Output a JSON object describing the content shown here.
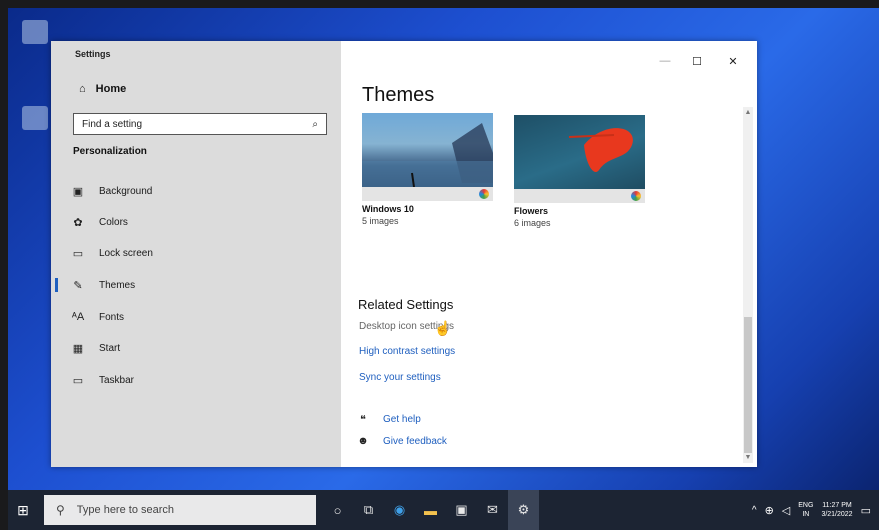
{
  "window": {
    "title": "Settings",
    "minimize": "—",
    "maximize": "☐",
    "close": "✕"
  },
  "sidebar": {
    "home": "Home",
    "search_placeholder": "Find a setting",
    "section": "Personalization",
    "items": [
      {
        "label": "Background",
        "icon": "background-icon",
        "glyph": "▣"
      },
      {
        "label": "Colors",
        "icon": "colors-icon",
        "glyph": "✿"
      },
      {
        "label": "Lock screen",
        "icon": "lock-screen-icon",
        "glyph": "▭"
      },
      {
        "label": "Themes",
        "icon": "themes-icon",
        "glyph": "✎",
        "active": true
      },
      {
        "label": "Fonts",
        "icon": "fonts-icon",
        "glyph": "ᴬA"
      },
      {
        "label": "Start",
        "icon": "start-icon",
        "glyph": "▦"
      },
      {
        "label": "Taskbar",
        "icon": "taskbar-icon",
        "glyph": "▭"
      }
    ]
  },
  "main": {
    "title": "Themes",
    "themes": [
      {
        "name": "Windows 10",
        "count": "5 images"
      },
      {
        "name": "Flowers",
        "count": "6 images"
      }
    ],
    "related_title": "Related Settings",
    "links": [
      "Desktop icon settings",
      "High contrast settings",
      "Sync your settings"
    ],
    "help": [
      {
        "label": "Get help",
        "icon": "get-help-icon"
      },
      {
        "label": "Give feedback",
        "icon": "give-feedback-icon"
      }
    ]
  },
  "taskbar": {
    "search_placeholder": "Type here to search",
    "lang_top": "ENG",
    "lang_bottom": "IN",
    "time": "11:27 PM",
    "date": "3/21/2022"
  },
  "colors": {
    "accent": "#1f5fbf",
    "sidebar_bg": "#dcdcdc",
    "taskbar_bg": "#1c2433"
  }
}
